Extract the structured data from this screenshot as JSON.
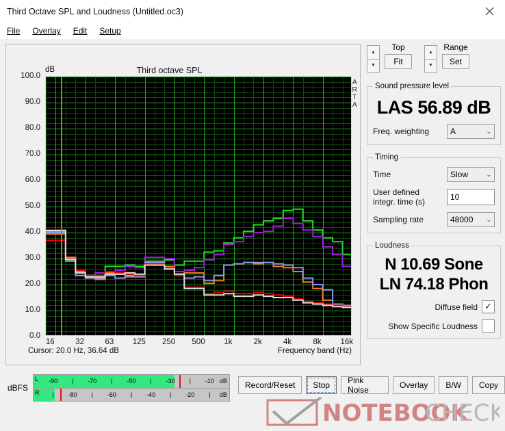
{
  "window": {
    "title": "Third Octave SPL and Loudness (Untitled.oc3)",
    "close_icon": "close-icon"
  },
  "menu": [
    {
      "label": "File",
      "mnemonic": "F"
    },
    {
      "label": "Overlay",
      "mnemonic": "O"
    },
    {
      "label": "Edit",
      "mnemonic": "E"
    },
    {
      "label": "Setup",
      "mnemonic": "S"
    }
  ],
  "graph": {
    "title": "Third octave SPL",
    "y_unit": "dB",
    "watermark_side": "ARTA",
    "cursor_text": "Cursor:   20.0 Hz, 36.64 dB",
    "xaxis_title": "Frequency band (Hz)"
  },
  "controls": {
    "top_label": "Top",
    "top_button": "Fit",
    "range_label": "Range",
    "range_button": "Set",
    "spin_up_icon": "chevron-up-icon",
    "spin_down_icon": "chevron-down-icon"
  },
  "spl": {
    "legend": "Sound pressure level",
    "value": "LAS 56.89 dB",
    "weighting_label": "Freq. weighting",
    "weighting_value": "A"
  },
  "timing": {
    "legend": "Timing",
    "time_label": "Time",
    "time_value": "Slow",
    "integr_label_line1": "User defined",
    "integr_label_line2": "integr. time (s)",
    "integr_value": "10",
    "sampling_label": "Sampling rate",
    "sampling_value": "48000"
  },
  "loudness": {
    "legend": "Loudness",
    "value_n": "N 10.69 Sone",
    "value_ln": "LN 74.18 Phon",
    "diffuse_label": "Diffuse field",
    "diffuse_checked": true,
    "specific_label": "Show Specific Loudness",
    "specific_checked": false,
    "check_glyph": "✓"
  },
  "meter": {
    "label": "dBFS",
    "left_channel": "L",
    "right_channel": "R",
    "unit": "dB",
    "top_ticks": [
      "-90",
      "-70",
      "-50",
      "-30",
      "-10"
    ],
    "bottom_ticks": [
      "-80",
      "-60",
      "-40",
      "-20"
    ],
    "left_fill_pct": 72,
    "left_peak_pct": 74.5,
    "right_fill_pct": 11,
    "right_peak_pct": 13.5,
    "fill_color": "#33e87f",
    "peak_color": "#e81010"
  },
  "buttons": [
    {
      "label": "Record/Reset",
      "focused": false
    },
    {
      "label": "Stop",
      "focused": true
    },
    {
      "label": "Pink Noise",
      "focused": false
    },
    {
      "label": "Overlay",
      "focused": false
    },
    {
      "label": "B/W",
      "focused": false
    },
    {
      "label": "Copy",
      "focused": false
    }
  ],
  "watermark": {
    "text_bold": "NOTEBOOK",
    "text_light": "CHECK",
    "color_bold": "#cf7b7b",
    "color_light": "#b4b4b4"
  },
  "chart_data": {
    "type": "line",
    "title": "Third octave SPL",
    "xlabel": "Frequency band (Hz)",
    "ylabel": "dB",
    "ylim": [
      0.0,
      100.0
    ],
    "ytick_step": 10.0,
    "yticks": [
      "0.0",
      "10.0",
      "20.0",
      "30.0",
      "40.0",
      "50.0",
      "60.0",
      "70.0",
      "80.0",
      "90.0",
      "100.0"
    ],
    "xticks": [
      "16",
      "32",
      "63",
      "125",
      "250",
      "500",
      "1k",
      "2k",
      "4k",
      "8k",
      "16k"
    ],
    "bands": [
      16,
      20,
      25,
      31.5,
      40,
      50,
      63,
      80,
      100,
      125,
      160,
      200,
      250,
      315,
      400,
      500,
      630,
      800,
      1000,
      1250,
      1600,
      2000,
      2500,
      3150,
      4000,
      5000,
      6300,
      8000,
      10000,
      12500,
      16000
    ],
    "grid": true,
    "background": "#000000",
    "grid_color_major": "#22aa22",
    "grid_color_minor": "#0d4a0d",
    "cursor_freq_hz": 20.0,
    "cursor_level_db": 36.64,
    "cursor_color": "#9a8a18",
    "series": [
      {
        "name": "green",
        "color": "#22dd22",
        "values": [
          40.5,
          40.5,
          29.5,
          25.0,
          23.5,
          24.5,
          27.0,
          27.0,
          27.5,
          27.0,
          29.0,
          29.0,
          29.5,
          27.5,
          29.0,
          29.0,
          32.5,
          33.0,
          36.0,
          38.0,
          40.5,
          43.0,
          44.5,
          45.5,
          48.5,
          49.0,
          44.5,
          41.0,
          38.0,
          36.5,
          31.5
        ]
      },
      {
        "name": "purple",
        "color": "#9b1fd8",
        "values": [
          41.0,
          41.0,
          30.5,
          23.5,
          22.5,
          24.5,
          25.0,
          25.5,
          27.0,
          26.5,
          30.5,
          30.5,
          30.0,
          25.0,
          25.5,
          26.5,
          29.5,
          31.5,
          35.5,
          36.5,
          38.5,
          40.0,
          40.5,
          42.5,
          45.5,
          43.5,
          41.0,
          38.5,
          34.5,
          31.5,
          27.0
        ]
      },
      {
        "name": "orange",
        "color": "#ff7a1a",
        "values": [
          39.5,
          39.5,
          30.5,
          25.0,
          22.5,
          22.0,
          24.5,
          24.0,
          23.5,
          23.5,
          28.5,
          28.5,
          27.0,
          24.0,
          24.5,
          24.5,
          20.5,
          21.5,
          27.5,
          28.0,
          28.5,
          28.0,
          28.5,
          27.0,
          26.5,
          25.0,
          21.0,
          18.5,
          14.0,
          12.5,
          11.5
        ]
      },
      {
        "name": "blue",
        "color": "#8a9ae8",
        "values": [
          40.0,
          40.0,
          29.0,
          23.5,
          22.5,
          22.5,
          23.5,
          22.5,
          23.0,
          23.0,
          28.5,
          28.5,
          26.5,
          24.0,
          22.5,
          23.0,
          21.5,
          23.5,
          27.5,
          28.0,
          28.5,
          28.5,
          28.5,
          28.0,
          27.5,
          26.5,
          22.5,
          20.0,
          18.0,
          12.5,
          12.0
        ]
      },
      {
        "name": "red",
        "color": "#f00000",
        "values": [
          37.0,
          37.0,
          30.0,
          25.5,
          23.5,
          23.5,
          25.0,
          24.5,
          24.0,
          23.5,
          28.0,
          28.0,
          26.5,
          23.5,
          19.0,
          19.0,
          16.5,
          17.0,
          17.5,
          16.5,
          16.5,
          17.0,
          16.5,
          16.0,
          15.5,
          14.5,
          13.5,
          13.0,
          12.5,
          12.0,
          11.5
        ]
      },
      {
        "name": "white",
        "color": "#dedede",
        "values": [
          40.8,
          40.8,
          29.8,
          24.5,
          23.0,
          23.0,
          24.0,
          24.0,
          24.5,
          24.0,
          27.5,
          27.5,
          26.0,
          24.0,
          18.5,
          18.5,
          16.0,
          16.0,
          16.5,
          15.5,
          15.5,
          16.0,
          15.5,
          15.0,
          15.0,
          14.0,
          13.0,
          12.5,
          12.0,
          11.5,
          11.2
        ]
      }
    ]
  }
}
